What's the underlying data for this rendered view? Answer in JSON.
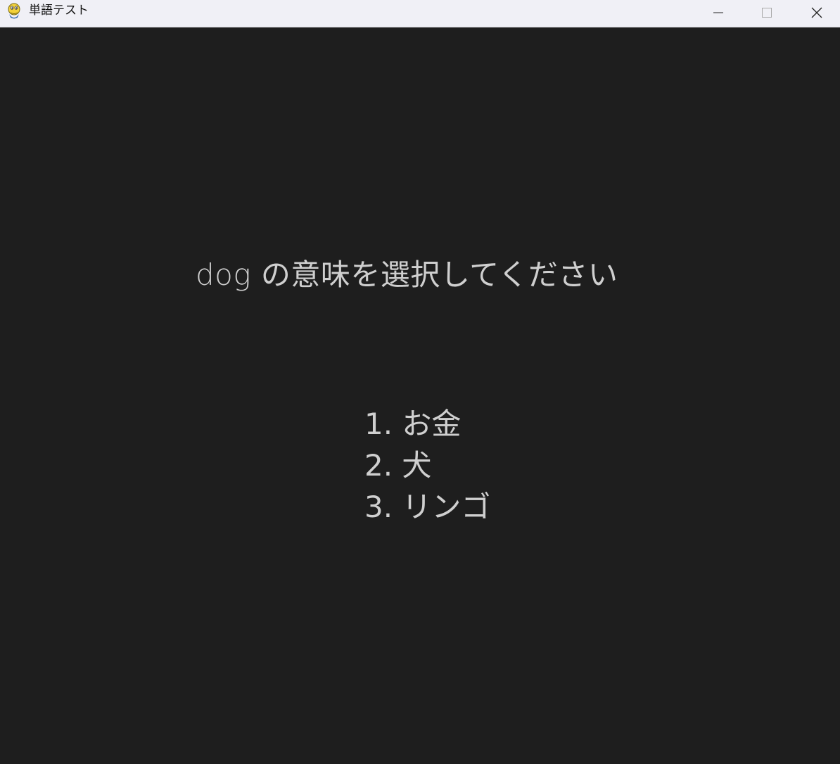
{
  "window": {
    "title": "単語テスト",
    "app_icon": "python-icon",
    "controls": {
      "minimize": "minimize-icon",
      "maximize": "maximize-icon",
      "close": "close-icon"
    }
  },
  "quiz": {
    "question": "dog の意味を選択してください",
    "options": [
      "1. お金",
      "2. 犬",
      "3. リンゴ"
    ]
  },
  "colors": {
    "background": "#1e1e1e",
    "text": "#cfcfcf",
    "titlebar": "#f0f0f6"
  }
}
